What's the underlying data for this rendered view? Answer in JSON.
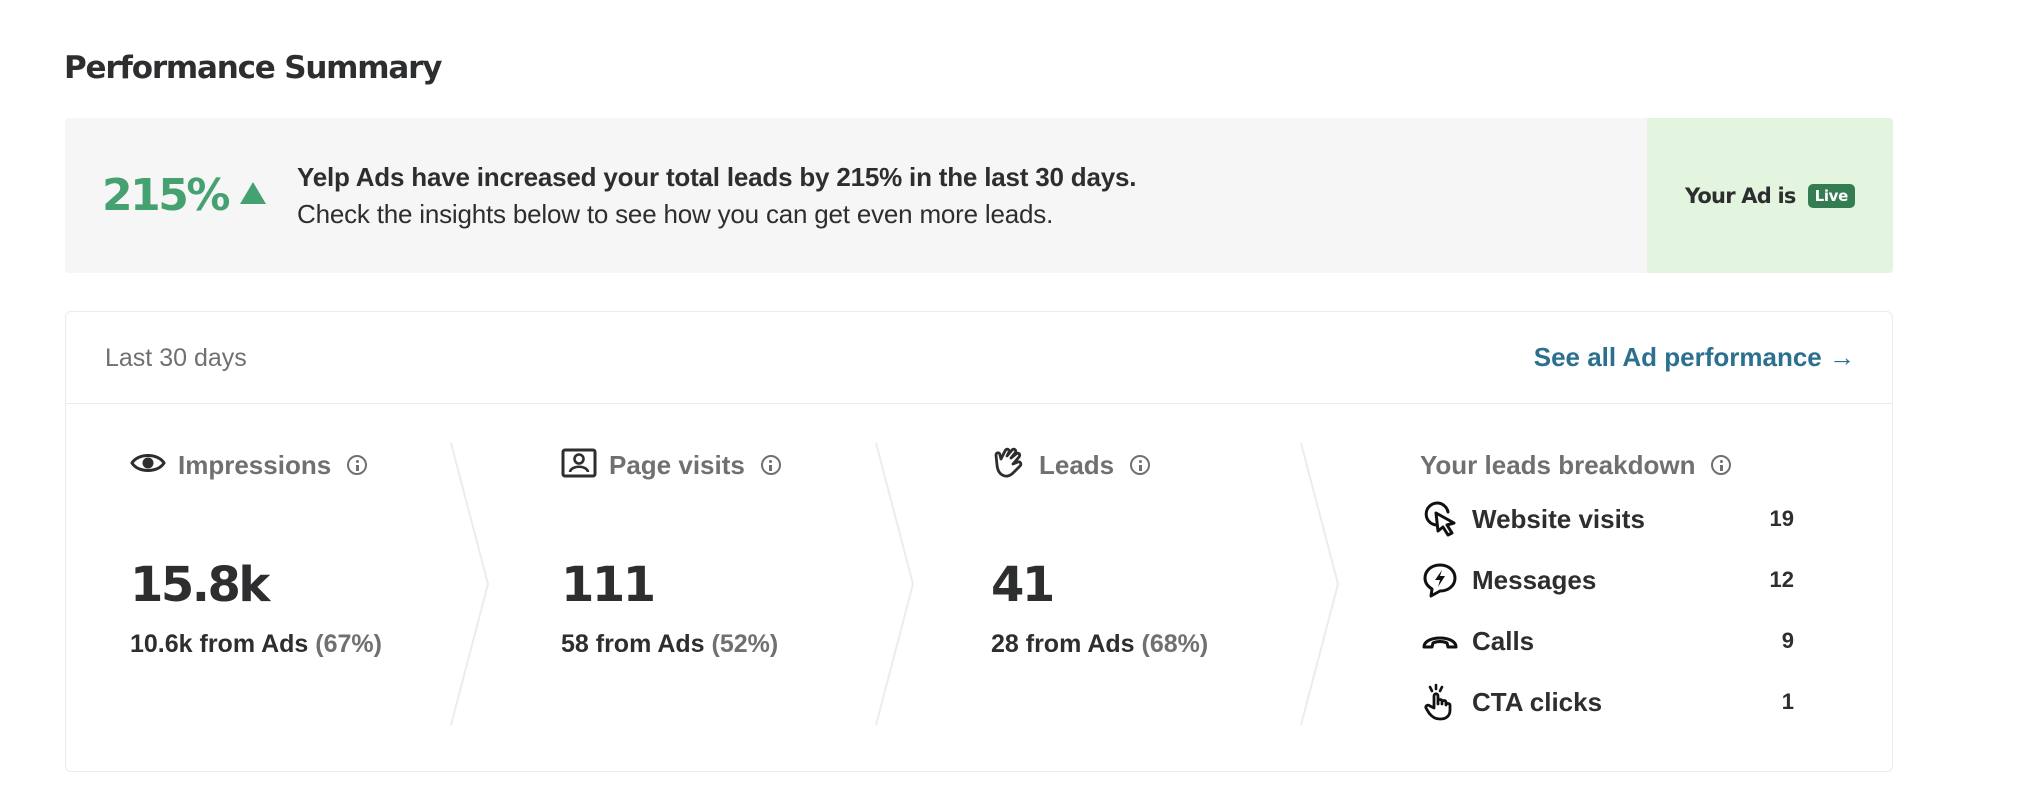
{
  "page": {
    "title": "Performance Summary"
  },
  "banner": {
    "increase_value": "215%",
    "increase_icon": "triangle-up-icon",
    "message_bold": "Yelp Ads have increased your total leads by 215% in the last 30 days.",
    "message_sub": "Check the insights below to see how you can get even more leads.",
    "status_text": "Your Ad is",
    "status_badge": "Live",
    "accent_color": "#46a171",
    "badge_color": "#347d53"
  },
  "card": {
    "period": "Last 30 days",
    "see_all_link": "See all Ad performance →",
    "link_color": "#2b708f"
  },
  "metrics": [
    {
      "label": "Impressions",
      "icon": "eye-icon",
      "value": "15.8k",
      "from_ads": "10.6k from Ads",
      "share": "(67%)"
    },
    {
      "label": "Page visits",
      "icon": "profile-card-icon",
      "value": "111",
      "from_ads": "58 from Ads",
      "share": "(52%)"
    },
    {
      "label": "Leads",
      "icon": "waving-hand-icon",
      "value": "41",
      "from_ads": "28 from Ads",
      "share": "(68%)"
    }
  ],
  "breakdown": {
    "title": "Your leads breakdown",
    "items": [
      {
        "label": "Website visits",
        "icon": "cursor-click-icon",
        "count": "19"
      },
      {
        "label": "Messages",
        "icon": "message-bolt-icon",
        "count": "12"
      },
      {
        "label": "Calls",
        "icon": "phone-icon",
        "count": "9"
      },
      {
        "label": "CTA clicks",
        "icon": "tap-hand-icon",
        "count": "1"
      }
    ]
  }
}
